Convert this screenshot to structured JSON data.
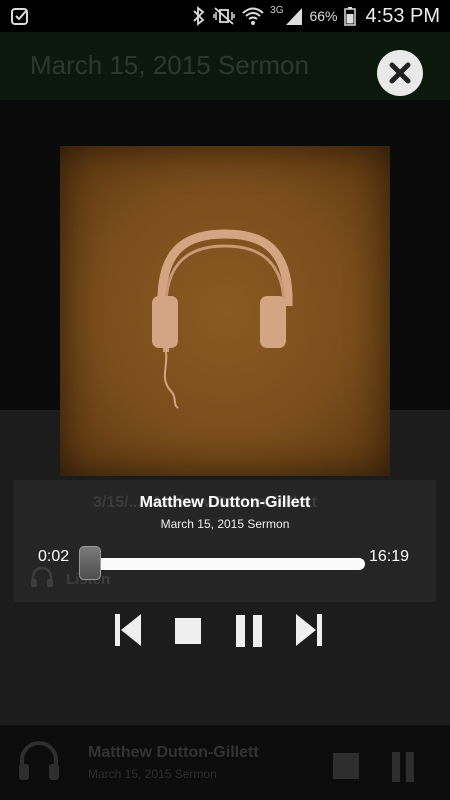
{
  "status_bar": {
    "net_type": "3G",
    "battery": "66%",
    "time": "4:53 PM"
  },
  "background": {
    "header_title": "March 15, 2015 Sermon",
    "card_title": "3/15/... Matthew Dutton-Gillett",
    "listen_label": "Listen"
  },
  "player": {
    "title": "Matthew Dutton-Gillett",
    "subtitle": "March 15, 2015 Sermon",
    "elapsed": "0:02",
    "duration": "16:19",
    "progress": 0.002
  },
  "mini_player": {
    "title": "Matthew Dutton-Gillett",
    "subtitle": "March 15, 2015 Sermon"
  },
  "colors": {
    "art_brown": "#7a4d1b",
    "headphone": "#d4a583",
    "control_white": "#efefef"
  },
  "icons": {
    "close": "close-icon",
    "prev": "skip-previous-icon",
    "stop": "stop-icon",
    "pause": "pause-icon",
    "next": "skip-next-icon",
    "headphones": "headphones-icon"
  }
}
